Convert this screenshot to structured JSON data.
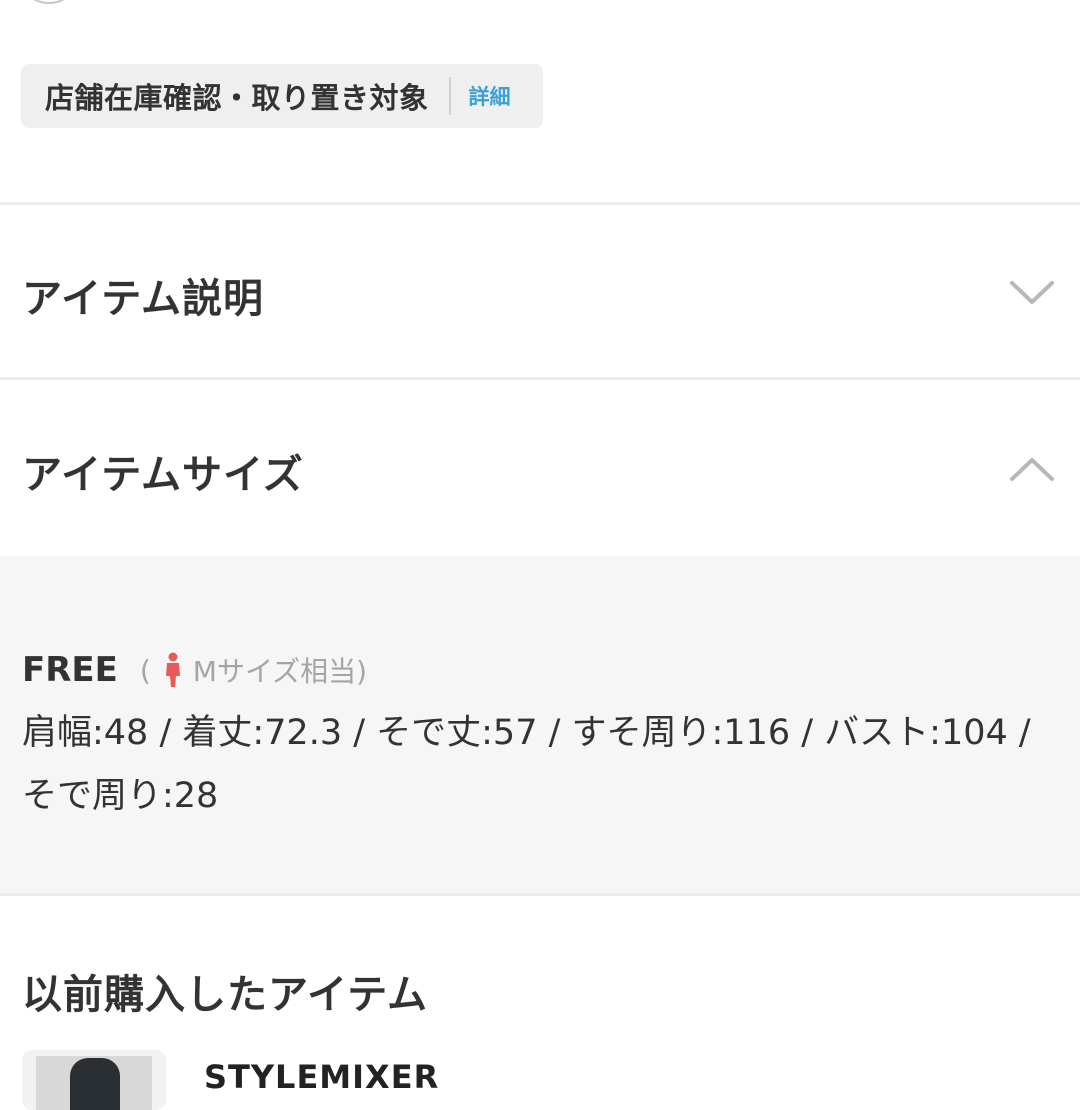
{
  "store_badge": {
    "label": "店舗在庫確認・取り置き対象",
    "link": "詳細"
  },
  "sections": {
    "description_title": "アイテム説明",
    "size_title": "アイテムサイズ"
  },
  "size_info": {
    "size_name": "FREE",
    "note_open": "(",
    "note_text": "Mサイズ相当)",
    "detail": "肩幅:48 / 着丈:72.3 / そで丈:57 / すそ周り:116 / バスト:104 / そで周り:28"
  },
  "previous": {
    "title": "以前購入したアイテム",
    "brand": "STYLEMIXER"
  },
  "colors": {
    "accent_link": "#3aa1d6",
    "person_icon": "#e85a5a"
  },
  "icons": {
    "description_toggle": "chevron-down-icon",
    "size_toggle": "chevron-up-icon",
    "size_person": "person-icon"
  }
}
